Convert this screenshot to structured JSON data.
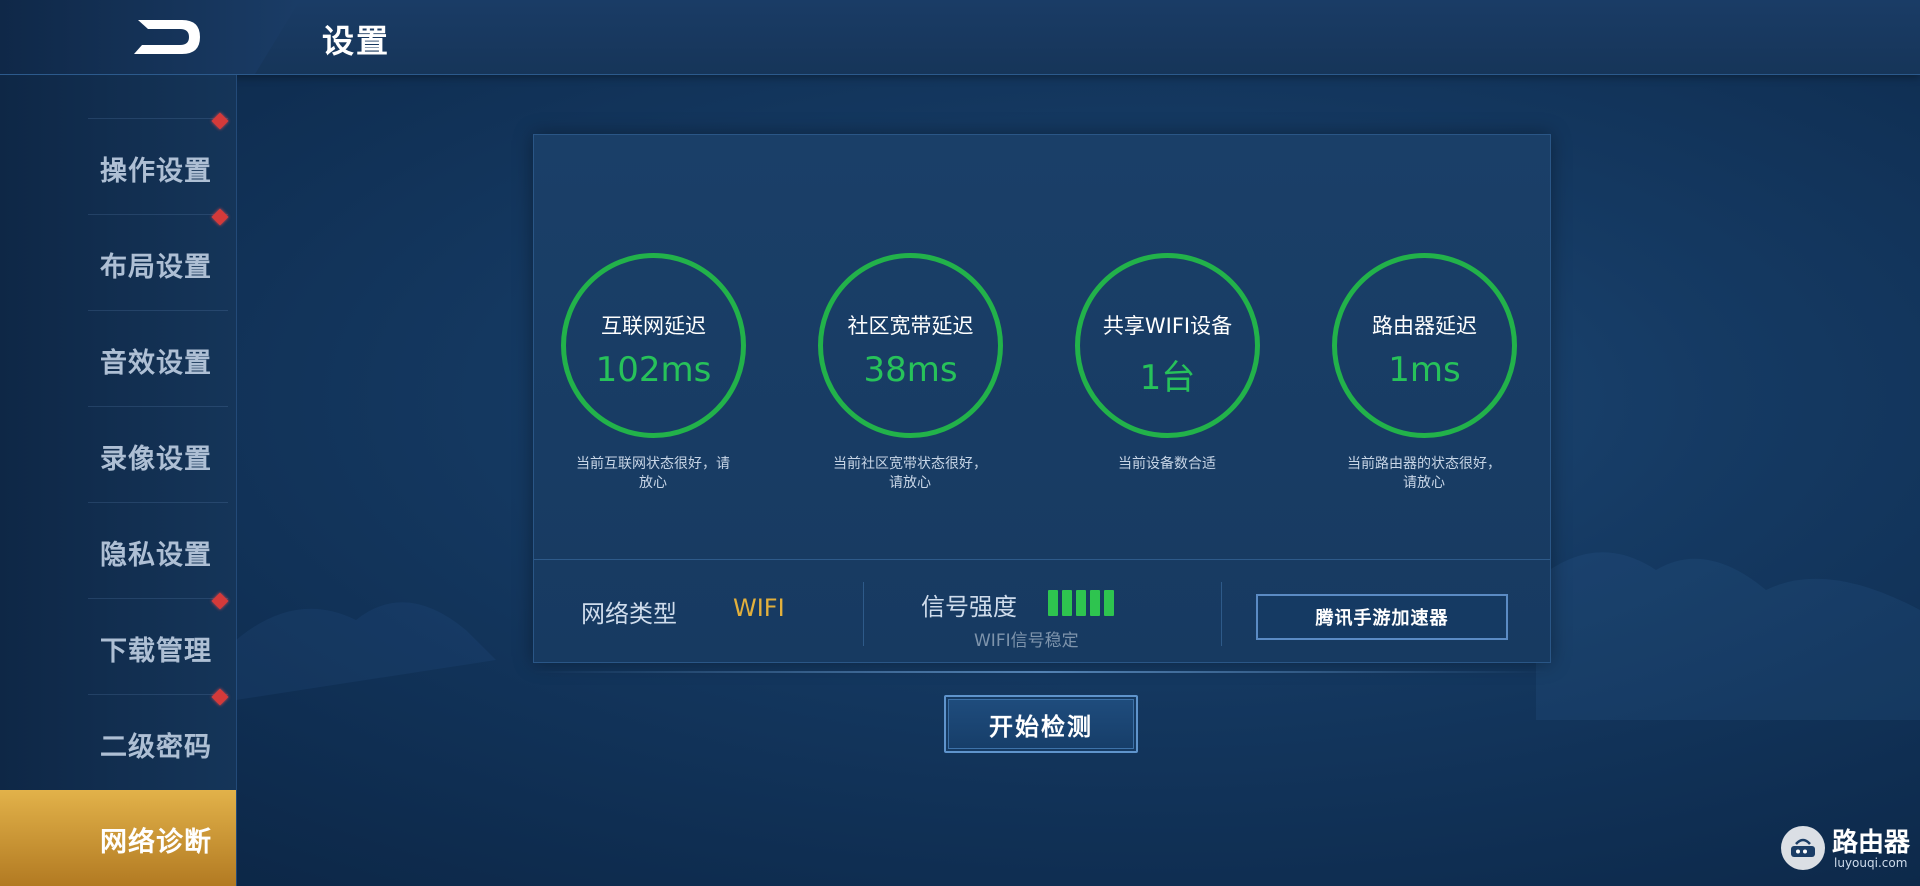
{
  "header": {
    "title": "设置"
  },
  "sidebar": {
    "items": [
      {
        "label": "操作设置",
        "badge": true
      },
      {
        "label": "布局设置",
        "badge": true
      },
      {
        "label": "音效设置",
        "badge": false
      },
      {
        "label": "录像设置",
        "badge": false
      },
      {
        "label": "隐私设置",
        "badge": false
      },
      {
        "label": "下载管理",
        "badge": true
      },
      {
        "label": "二级密码",
        "badge": true
      },
      {
        "label": "网络诊断",
        "badge": false,
        "active": true
      }
    ]
  },
  "metrics": [
    {
      "label": "互联网延迟",
      "value": "102ms",
      "note_line1": "当前互联网状态很好，请",
      "note_line2": "放心"
    },
    {
      "label": "社区宽带延迟",
      "value": "38ms",
      "note_line1": "当前社区宽带状态很好，",
      "note_line2": "请放心"
    },
    {
      "label": "共享WIFI设备",
      "value": "1台",
      "note_line1": "当前设备数合适",
      "note_line2": ""
    },
    {
      "label": "路由器延迟",
      "value": "1ms",
      "note_line1": "当前路由器的状态很好，",
      "note_line2": "请放心"
    }
  ],
  "network": {
    "type_label": "网络类型",
    "type_value": "WIFI",
    "signal_label": "信号强度",
    "signal_bars": 5,
    "signal_note": "WIFI信号稳定",
    "accelerator_label": "腾讯手游加速器"
  },
  "actions": {
    "start_label": "开始检测"
  },
  "watermark": {
    "title": "路由器",
    "subtitle": "luyouqi.com"
  },
  "colors": {
    "ring": "#22b24a",
    "value": "#27c25a",
    "accent_gold": "#e3b03c",
    "badge_red": "#d43a3a"
  }
}
